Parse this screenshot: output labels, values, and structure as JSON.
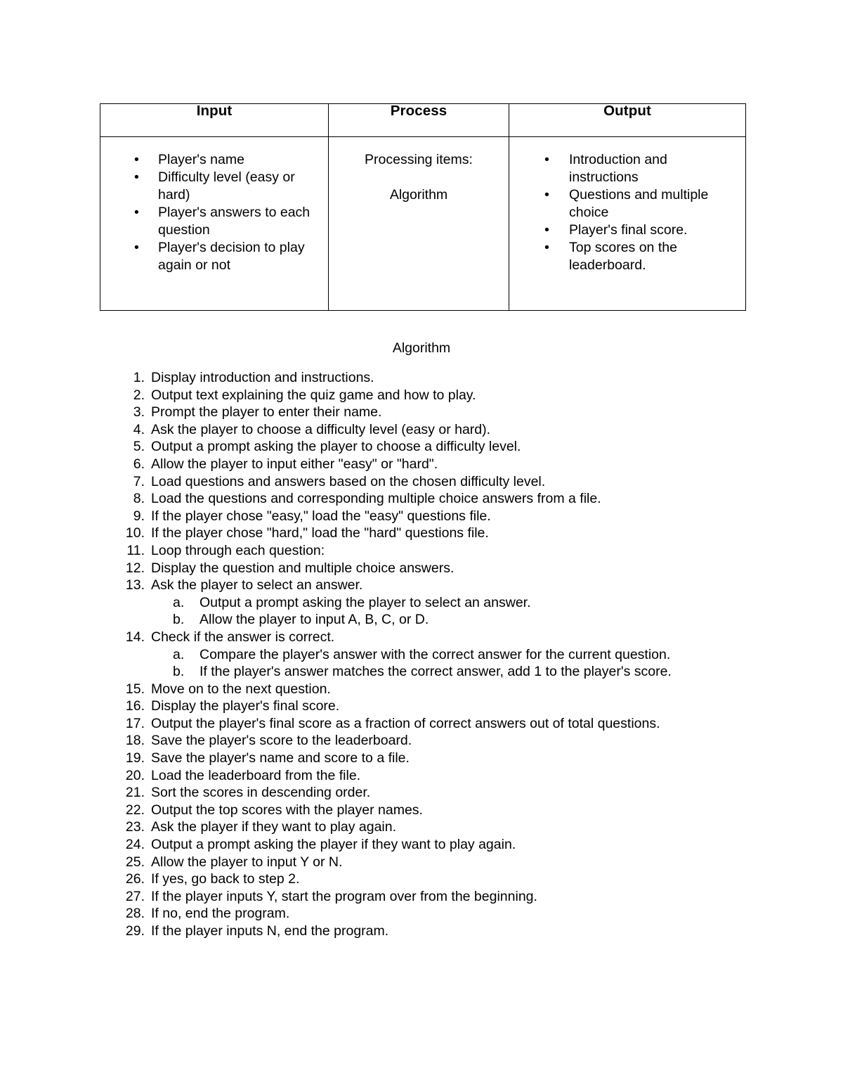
{
  "document": {
    "ipo_table": {
      "columns": [
        {
          "header": "Input"
        },
        {
          "header": "Process"
        },
        {
          "header": "Output"
        }
      ],
      "input_items": [
        "Player's name",
        "Difficulty level (easy or hard)",
        "Player's answers to each question",
        "Player's decision to play again or not"
      ],
      "process_lines": [
        "Processing items:",
        "Algorithm"
      ],
      "output_items": [
        "Introduction and instructions",
        "Questions and multiple choice",
        "Player's final score.",
        "Top scores on the leaderboard."
      ],
      "bullet_glyph": "•"
    },
    "algorithm": {
      "heading": "Algorithm",
      "steps": [
        {
          "number": "1.",
          "text": "Display introduction and instructions."
        },
        {
          "number": "2.",
          "text": "Output text explaining the quiz game and how to play."
        },
        {
          "number": "3.",
          "text": "Prompt the player to enter their name."
        },
        {
          "number": "4.",
          "text": "Ask the player to choose a difficulty level (easy or hard)."
        },
        {
          "number": "5.",
          "text": "Output a prompt asking the player to choose a difficulty level."
        },
        {
          "number": "6.",
          "text": "Allow the player to input either \"easy\" or \"hard\"."
        },
        {
          "number": "7.",
          "text": "Load questions and answers based on the chosen difficulty level."
        },
        {
          "number": "8.",
          "text": "Load the questions and corresponding multiple choice answers from a file."
        },
        {
          "number": "9.",
          "text": "If the player chose \"easy,\" load the \"easy\" questions file."
        },
        {
          "number": "10.",
          "text": "If the player chose \"hard,\" load the \"hard\" questions file."
        },
        {
          "number": "11.",
          "text": "Loop through each question:"
        },
        {
          "number": "12.",
          "text": "Display the question and multiple choice answers."
        },
        {
          "number": "13.",
          "text": "Ask the player to select an answer."
        },
        {
          "number": "a.",
          "text": "Output a prompt asking the player to select an answer.",
          "sub": true
        },
        {
          "number": "b.",
          "text": "Allow the player to input A, B, C, or D.",
          "sub": true
        },
        {
          "number": "14.",
          "text": "Check if the answer is correct."
        },
        {
          "number": "a.",
          "text": "Compare the player's answer with the correct answer for the current question.",
          "sub": true
        },
        {
          "number": "b.",
          "text": "If the player's answer matches the correct answer, add 1 to the player's score.",
          "sub": true
        },
        {
          "number": "15.",
          "text": "Move on to the next question."
        },
        {
          "number": "16.",
          "text": "Display the player's final score."
        },
        {
          "number": "17.",
          "text": "Output the player's final score as a fraction of correct answers out of total questions."
        },
        {
          "number": "18.",
          "text": "Save the player's score to the leaderboard."
        },
        {
          "number": "19.",
          "text": "Save the player's name and score to a file."
        },
        {
          "number": "20.",
          "text": "Load the leaderboard from the file."
        },
        {
          "number": "21.",
          "text": "Sort the scores in descending order."
        },
        {
          "number": "22.",
          "text": "Output the top scores with the player names."
        },
        {
          "number": "23.",
          "text": "Ask the player if they want to play again."
        },
        {
          "number": "24.",
          "text": "Output a prompt asking the player if they want to play again."
        },
        {
          "number": "25.",
          "text": "Allow the player to input Y or N."
        },
        {
          "number": "26.",
          "text": "If yes, go back to step 2."
        },
        {
          "number": "27.",
          "text": "If the player inputs Y, start the program over from the beginning."
        },
        {
          "number": "28.",
          "text": "If no, end the program."
        },
        {
          "number": "29.",
          "text": "If the player inputs N, end the program."
        }
      ]
    }
  }
}
